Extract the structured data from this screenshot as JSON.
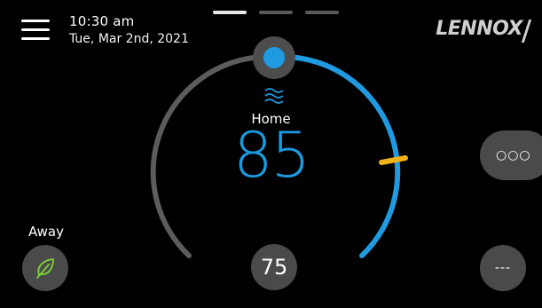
{
  "header": {
    "time": "10:30 am",
    "date": "Tue, Mar 2nd, 2021",
    "logo": "LENNOX"
  },
  "pager": {
    "pages": 3,
    "active_index": 0
  },
  "thermostat": {
    "mode_label": "Home",
    "current_temp": "85",
    "setpoint_temp": "75",
    "fan_icon": "fan-waves-icon",
    "dial_color": "#1f9ae0",
    "track_color": "#5c5c5c",
    "marker_color": "#f0b21a"
  },
  "away": {
    "label": "Away",
    "icon": "leaf-icon",
    "icon_color": "#7cd43a"
  },
  "right_buttons": {
    "more_label": "○○○",
    "aux_label": "---"
  }
}
